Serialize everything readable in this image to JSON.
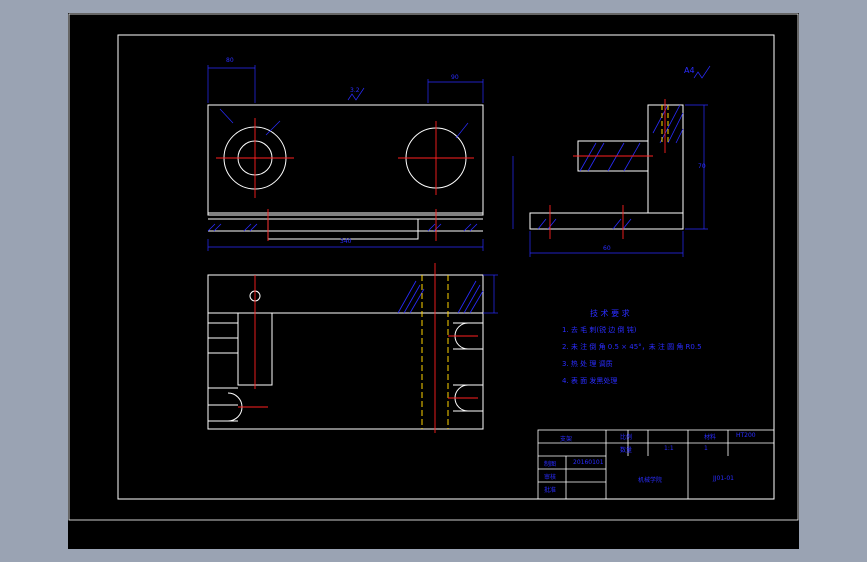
{
  "palette": {
    "outer_bg": "#9aa3b3",
    "paper": "#000000",
    "frame": "#ffffff",
    "outline": "#ffffff",
    "dimension": "#2a2cff",
    "centerline": "#ff2020",
    "hidden_line": "#ffd400",
    "hatch": "#2a2cff"
  },
  "views": {
    "front": {
      "name": "front-view"
    },
    "top": {
      "name": "top-view"
    },
    "side": {
      "name": "side-view"
    }
  },
  "annotations": {
    "scale_mark": "A4",
    "roughness_note": "3.2",
    "dim_top_left": "80",
    "dim_top_right": "90",
    "dim_bottom_width": "340",
    "dim_side_width": "60",
    "dim_side_height": "70"
  },
  "tech_requirements": {
    "title": "技 术 要 求",
    "items": [
      "1. 去 毛 刺(锐 边 倒 钝)",
      "2. 未 注 倒 角 0.5 × 45°，未 注 圆 角 R0.5",
      "3. 热 处 理 调质",
      "4. 表 面 发黑处理"
    ]
  },
  "title_block": {
    "part_name": "支架",
    "label_material": "材料",
    "label_scale": "比例",
    "scale_value": "1:1",
    "label_qty": "数量",
    "qty_value": "1",
    "label_drawn": "制图",
    "label_checked": "审核",
    "label_approved": "批准",
    "student_no": "20160101",
    "school": "机械学院",
    "material_value": "HT200",
    "drawing_no": "JJ01-01"
  }
}
